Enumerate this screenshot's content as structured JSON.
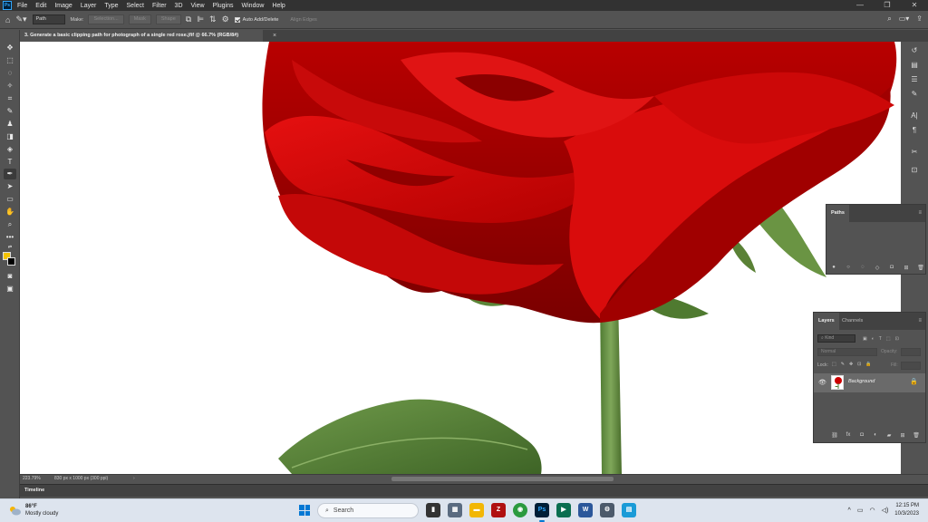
{
  "app": {
    "logo": "Ps",
    "menus": [
      "File",
      "Edit",
      "Image",
      "Layer",
      "Type",
      "Select",
      "Filter",
      "3D",
      "View",
      "Plugins",
      "Window",
      "Help"
    ]
  },
  "options": {
    "mode_value": "Path",
    "make_label": "Make:",
    "selection_btn": "Selection...",
    "mask_btn": "Mask",
    "shape_btn": "Shape",
    "auto_add_delete": "Auto Add/Delete",
    "align_edges": "Align Edges"
  },
  "document": {
    "tab_title": "3. Generate a basic clipping path for photograph of a single red rose.jfif @ 66.7% (RGB/8#)",
    "zoom": "223.79%",
    "info": "830 px x 1000 px (300 ppi)"
  },
  "colors": {
    "foreground": "#f2c200",
    "background": "#000000"
  },
  "timeline_label": "Timeline",
  "paths_panel": {
    "tab": "Paths"
  },
  "layers_panel": {
    "tabs": [
      "Layers",
      "Channels"
    ],
    "kind_placeholder": "Kind",
    "blend_mode": "Normal",
    "opacity_label": "Opacity:",
    "lock_label": "Lock:",
    "fill_label": "Fill:",
    "layer_name": "Background"
  },
  "taskbar": {
    "temperature": "86°F",
    "weather": "Mostly cloudy",
    "search_placeholder": "Search",
    "time": "12:15 PM",
    "date": "10/3/2023"
  }
}
